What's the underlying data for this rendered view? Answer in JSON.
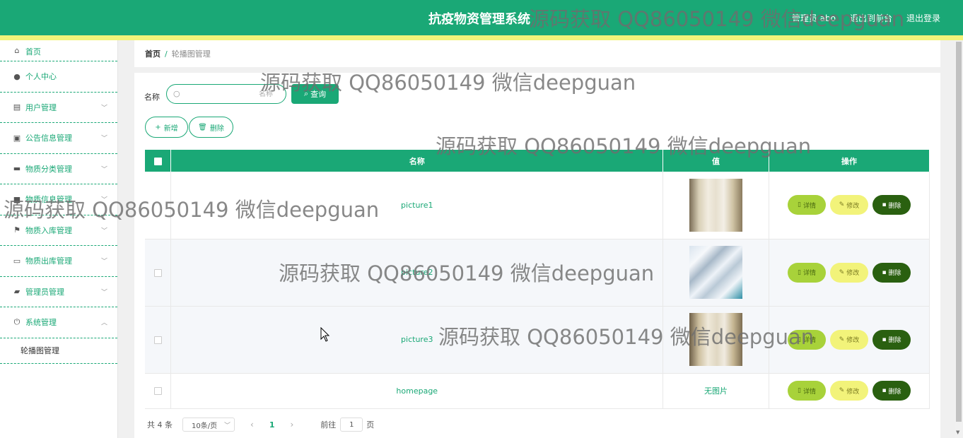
{
  "header": {
    "title": "抗疫物资管理系统",
    "links": [
      "管理员 abo",
      "退出到前台",
      "退出登录"
    ]
  },
  "sidebar": {
    "items": [
      {
        "label": "首页",
        "icon": "home-icon"
      },
      {
        "label": "个人中心",
        "icon": "user-icon"
      },
      {
        "label": "用户管理",
        "icon": "chart-icon"
      },
      {
        "label": "公告信息管理",
        "icon": "clipboard-icon"
      },
      {
        "label": "物质分类管理",
        "icon": "briefcase-icon"
      },
      {
        "label": "物质信息管理",
        "icon": "box-icon"
      },
      {
        "label": "物质入库管理",
        "icon": "flag-icon"
      },
      {
        "label": "物质出库管理",
        "icon": "chat-icon"
      },
      {
        "label": "管理员管理",
        "icon": "wallet-icon"
      },
      {
        "label": "系统管理",
        "icon": "power-icon"
      }
    ],
    "submenu": [
      "轮播图管理"
    ]
  },
  "breadcrumb": {
    "home": "首页",
    "separator": "/",
    "current": "轮播图管理"
  },
  "search": {
    "label": "名称",
    "placeholder": "名称",
    "button": "查询"
  },
  "actions": {
    "add": "新增",
    "delete": "删除"
  },
  "table": {
    "headers": [
      "名称",
      "值",
      "操作"
    ],
    "rows": [
      {
        "name": "picture1",
        "value": "image",
        "thumb": "t1"
      },
      {
        "name": "picture2",
        "value": "image",
        "thumb": "t2"
      },
      {
        "name": "picture3",
        "value": "image",
        "thumb": "t3"
      },
      {
        "name": "homepage",
        "value": "无图片",
        "thumb": ""
      }
    ],
    "ops": {
      "detail": "详情",
      "edit": "修改",
      "delete": "删除"
    }
  },
  "pagination": {
    "total": "共 4 条",
    "page_size": "10条/页",
    "current": "1",
    "goto_label": "前往",
    "goto_value": "1",
    "page_unit": "页"
  },
  "watermark": "源码获取 QQ86050149 微信deepguan",
  "colors": {
    "primary": "#1aa876",
    "accent": "#f2f37a",
    "detail": "#a8d23a",
    "danger": "#2a6010"
  }
}
